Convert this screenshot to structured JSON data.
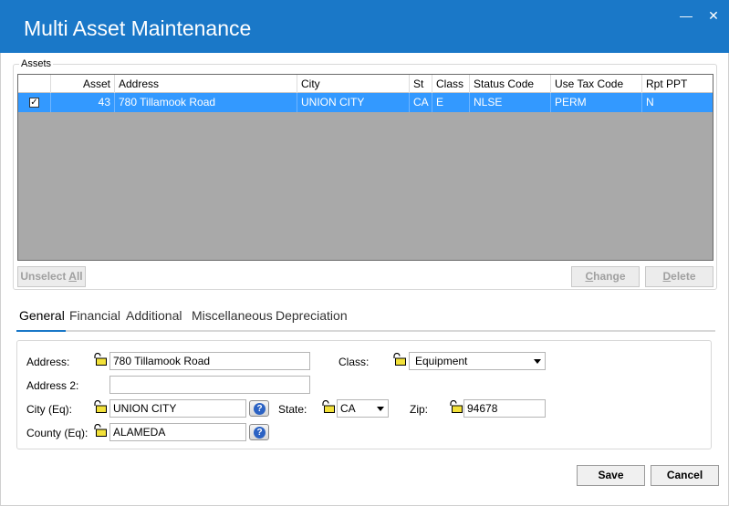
{
  "window": {
    "title": "Multi Asset Maintenance",
    "minimize_glyph": "—",
    "close_glyph": "✕"
  },
  "assets_group": {
    "label": "Assets",
    "columns": [
      "",
      "Asset",
      "Address",
      "City",
      "St",
      "Class",
      "Status Code",
      "Use Tax Code",
      "Rpt PPT"
    ],
    "rows": [
      {
        "checked": true,
        "check_glyph": "✓",
        "asset": "43",
        "address": "780 Tillamook Road",
        "city": "UNION CITY",
        "st": "CA",
        "class": "E",
        "status_code": "NLSE",
        "use_tax_code": "PERM",
        "rpt_ppt": "N"
      }
    ],
    "buttons": {
      "unselect_all_prefix": "Unselect ",
      "unselect_all_underline": "A",
      "unselect_all_suffix": "ll",
      "change_prefix": "",
      "change_underline": "C",
      "change_suffix": "hange",
      "delete_prefix": "",
      "delete_underline": "D",
      "delete_suffix": "elete"
    }
  },
  "tabs": [
    {
      "label": "General",
      "active": true
    },
    {
      "label": "Financial",
      "active": false
    },
    {
      "label": "Additional",
      "active": false
    },
    {
      "label": "Miscellaneous",
      "active": false
    },
    {
      "label": "Depreciation",
      "active": false
    }
  ],
  "general": {
    "address_label": "Address:",
    "address_value": "780 Tillamook Road",
    "address2_label": "Address 2:",
    "address2_value": "",
    "city_label": "City (Eq):",
    "city_value": "UNION CITY",
    "county_label": "County (Eq):",
    "county_value": "ALAMEDA",
    "class_label": "Class:",
    "class_value": "Equipment",
    "state_label": "State:",
    "state_value": "CA",
    "zip_label": "Zip:",
    "zip_value": "94678",
    "help_glyph": "?"
  },
  "footer": {
    "save_label": "Save",
    "cancel_label": "Cancel"
  },
  "icons": {
    "lock": "lock-icon",
    "help": "help-icon",
    "dropdown": "chevron-down-icon"
  },
  "colors": {
    "titlebar": "#1a78c8",
    "selection": "#3399ff",
    "grid_background": "#a9a9a9",
    "lock_yellow": "#f2e13a"
  }
}
